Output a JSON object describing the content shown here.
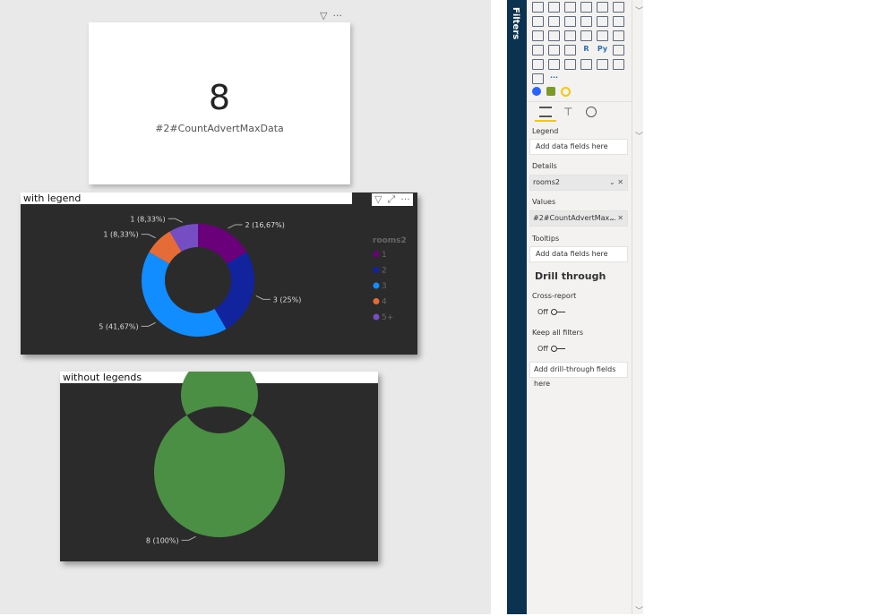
{
  "kpi": {
    "value": "8",
    "label": "#2#CountAdvertMaxData"
  },
  "visual1": {
    "title": "with legend",
    "legend_title": "rooms2"
  },
  "visual2": {
    "title": "without legends"
  },
  "icons": {
    "filter": "filter-icon",
    "more": "more-options-icon",
    "focus": "focus-mode-icon"
  },
  "filters_pane": {
    "label": "Filters"
  },
  "viz_icons": [
    "stacked-bar",
    "area",
    "line-area",
    "stacked-column",
    "clustered-column",
    "ribbon",
    "waterfall",
    "funnel",
    "scatter",
    "pie",
    "donut",
    "treemap",
    "map",
    "filled-map",
    "gauge",
    "card",
    "multi-row-card",
    "kpi",
    "slicer",
    "table",
    "matrix",
    "r-visual",
    "python-visual",
    "key-influencers",
    "decomposition-tree",
    "qa",
    "paginated",
    "smart-narrative",
    "power-apps",
    "custom",
    "power-automate",
    "more"
  ],
  "viz_icon_text": {
    "r-visual": "R",
    "python-visual": "Py",
    "more": "···"
  },
  "fields": {
    "legend_label": "Legend",
    "legend_placeholder": "Add data fields here",
    "details_label": "Details",
    "details_value": "rooms2",
    "values_label": "Values",
    "values_value": "#2#CountAdvertMax...",
    "tooltips_label": "Tooltips",
    "tooltips_placeholder": "Add data fields here"
  },
  "drill": {
    "title": "Drill through",
    "cross_report": "Cross-report",
    "cross_report_state": "Off",
    "keep_filters": "Keep all filters",
    "keep_filters_state": "Off",
    "placeholder": "Add drill-through fields here"
  },
  "chart_data": [
    {
      "type": "donut",
      "title": "with legend",
      "legend": "right",
      "legend_title": "rooms2",
      "categories": [
        "1",
        "2",
        "3",
        "4",
        "5+"
      ],
      "values": [
        2,
        3,
        5,
        1,
        1
      ],
      "data_labels": [
        "2 (16,67%)",
        "3 (25%)",
        "5 (41,67%)",
        "1 (8,33%)",
        "1 (8,33%)"
      ],
      "colors": [
        "#6b007b",
        "#12239e",
        "#118dff",
        "#e66c37",
        "#744ec2"
      ]
    },
    {
      "type": "donut",
      "title": "without legends",
      "legend": "none",
      "categories": [
        "8"
      ],
      "values": [
        8
      ],
      "data_labels": [
        "8 (100%)"
      ],
      "colors": [
        "#4a8f44"
      ]
    }
  ]
}
